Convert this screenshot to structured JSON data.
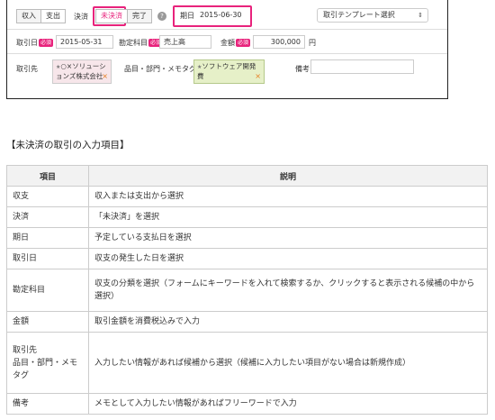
{
  "form": {
    "type_buttons": [
      "収入",
      "支出"
    ],
    "settlement_label": "決済",
    "settlement_buttons": [
      "未決済",
      "完了"
    ],
    "help_icon": "question-circle-icon",
    "due_label": "期日",
    "due_value": "2015-06-30",
    "template_select": "取引テンプレート選択",
    "date_label": "取引日",
    "required_badge": "必須",
    "date_value": "2015-05-31",
    "account_label": "勘定科目",
    "account_value": "売上高",
    "amount_label": "金額",
    "amount_value": "300,000",
    "amount_unit": "円",
    "partner_label": "取引先",
    "partner_value": "○×ソリューションズ株式会社",
    "items_label": "品目・部門・メモタグ",
    "items_value": "ソフトウェア開発費",
    "note_label": "備考",
    "accent_color": "#e8237c"
  },
  "section_title": "【未決済の取引の入力項目】",
  "table": {
    "headers": [
      "項目",
      "説明"
    ],
    "rows": [
      [
        "収支",
        "収入または支出から選択"
      ],
      [
        "決済",
        "「未決済」を選択"
      ],
      [
        "期日",
        "予定している支払日を選択"
      ],
      [
        "取引日",
        "収支の発生した日を選択"
      ],
      [
        "勘定科目",
        "収支の分類を選択（フォームにキーワードを入れて検索するか、クリックすると表示される候補の中から選択）"
      ],
      [
        "金額",
        "取引金額を消費税込みで入力"
      ],
      [
        "取引先\n品目・部門・メモタグ",
        "入力したい情報があれば候補から選択（候補に入力したい項目がない場合は新規作成）"
      ],
      [
        "備考",
        "メモとして入力したい情報があればフリーワードで入力"
      ]
    ]
  }
}
